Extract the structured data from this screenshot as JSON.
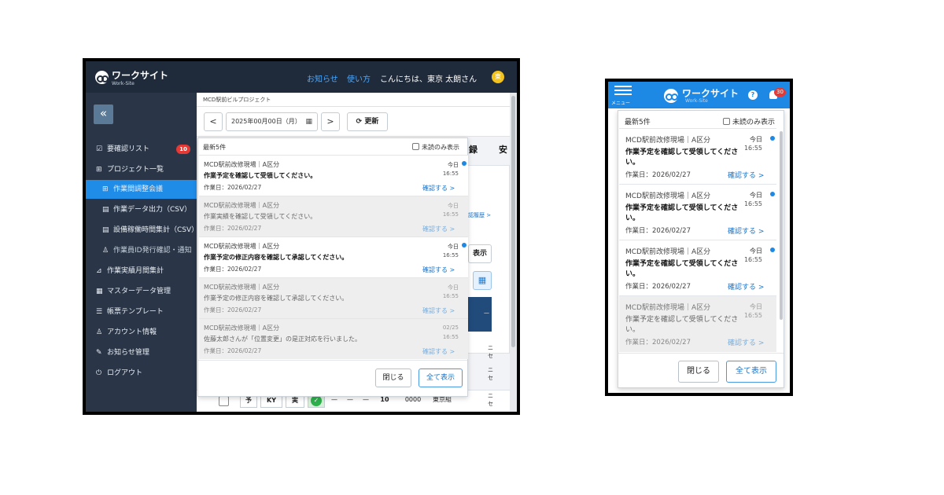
{
  "brand": {
    "name": "ワークサイト",
    "sub": "Work-Site"
  },
  "header": {
    "news_link": "お知らせ",
    "usage_link": "使い方",
    "greeting": "こんにちは、東京 太朗さん",
    "avatar": "東"
  },
  "sidebar": {
    "collapse": "«",
    "items": [
      {
        "label": "要確認リスト",
        "icon": "☑",
        "badge": "10"
      },
      {
        "label": "プロジェクト一覧",
        "icon": "⊞"
      },
      {
        "label": "作業間調整会議",
        "icon": "⊞"
      },
      {
        "label": "作業データ出力（CSV）",
        "icon": "▤"
      },
      {
        "label": "設備稼働時間集計（CSV）",
        "icon": "▤"
      },
      {
        "label": "作業員ID発行確認・通知",
        "icon": "♙"
      },
      {
        "label": "作業実績月間集計",
        "icon": "⊿"
      },
      {
        "label": "マスターデータ管理",
        "icon": "▦"
      },
      {
        "label": "帳票テンプレート",
        "icon": "☰"
      },
      {
        "label": "アカウント情報",
        "icon": "♙"
      },
      {
        "label": "お知らせ管理",
        "icon": "✎"
      },
      {
        "label": "ログアウト",
        "icon": "⏻"
      }
    ]
  },
  "main": {
    "breadcrumb": "MCD駅前ビルプロジェクト",
    "prev": "<",
    "date": "2025年00月00日（月）",
    "next": ">",
    "refresh": "⟳ 更新",
    "bg_word1": "録",
    "bg_word2": "安",
    "bg_link": "認履歴 >",
    "bg_btn": "表示",
    "bg_col_dash": "—",
    "bg_col_se": "ニ\nセ",
    "row": [
      "予",
      "KY",
      "実",
      "—",
      "—",
      "—",
      "—",
      "10",
      "0000",
      "東京組"
    ],
    "row_ok": "✓"
  },
  "notif_popup": {
    "header": "最新5件",
    "unread_label": "未読のみ表示",
    "items": [
      {
        "site": "MCD駅前改修現場｜A区分",
        "msg": "作業予定を確認して受領してください。",
        "workdate": "作業日：2026/02/27",
        "day": "今日",
        "time": "16:55",
        "link": "確認する >",
        "read": false
      },
      {
        "site": "MCD駅前改修現場｜A区分",
        "msg": "作業実績を確認して受領してください。",
        "workdate": "作業日：2026/02/27",
        "day": "今日",
        "time": "16:55",
        "link": "確認する >",
        "read": true
      },
      {
        "site": "MCD駅前改修現場｜A区分",
        "msg": "作業予定の修正内容を確認して承認してください。",
        "workdate": "作業日：2026/02/27",
        "day": "今日",
        "time": "16:55",
        "link": "確認する >",
        "read": false
      },
      {
        "site": "MCD駅前改修現場｜A区分",
        "msg": "作業予定の修正内容を確認して承認してください。",
        "workdate": "作業日：2026/02/27",
        "day": "今日",
        "time": "16:55",
        "link": "確認する >",
        "read": true
      },
      {
        "site": "MCD駅前改修現場｜A区分",
        "msg": "佐藤太郎さんが「位置変更」の是正対応を行いました。",
        "workdate": "作業日：2026/02/27",
        "day": "02/25",
        "time": "16:55",
        "link": "確認する >",
        "read": true
      }
    ],
    "close": "閉じる",
    "show_all": "全て表示"
  },
  "mobile": {
    "menu": "メニュー",
    "help": "?",
    "badge": "30",
    "header": "最新5件",
    "unread_label": "未読のみ表示",
    "items": [
      {
        "site": "MCD駅前改修現場｜A区分",
        "msg1": "作業予定を確認して受領してくださ",
        "msg2": "い。",
        "workdate": "作業日：2026/02/27",
        "day": "今日",
        "time": "16:55",
        "link": "確認する >",
        "read": false
      },
      {
        "site": "MCD駅前改修現場｜A区分",
        "msg1": "作業予定を確認して受領してくださ",
        "msg2": "い。",
        "workdate": "作業日：2026/02/27",
        "day": "今日",
        "time": "16:55",
        "link": "確認する >",
        "read": false
      },
      {
        "site": "MCD駅前改修現場｜A区分",
        "msg1": "作業予定を確認して受領してくださ",
        "msg2": "い。",
        "workdate": "作業日：2026/02/27",
        "day": "今日",
        "time": "16:55",
        "link": "確認する >",
        "read": false
      },
      {
        "site": "MCD駅前改修現場｜A区分",
        "msg1": "作業予定を確認して受領してくださ",
        "msg2": "い。",
        "workdate": "作業日：2026/02/27",
        "day": "今日",
        "time": "16:55",
        "link": "確認する >",
        "read": true
      }
    ],
    "close": "閉じる",
    "show_all": "全て表示"
  },
  "colors": {
    "accent": "#1e88e5",
    "sidebar": "#2a3648",
    "topbar": "#1f2a3a",
    "badge": "#e53935"
  }
}
